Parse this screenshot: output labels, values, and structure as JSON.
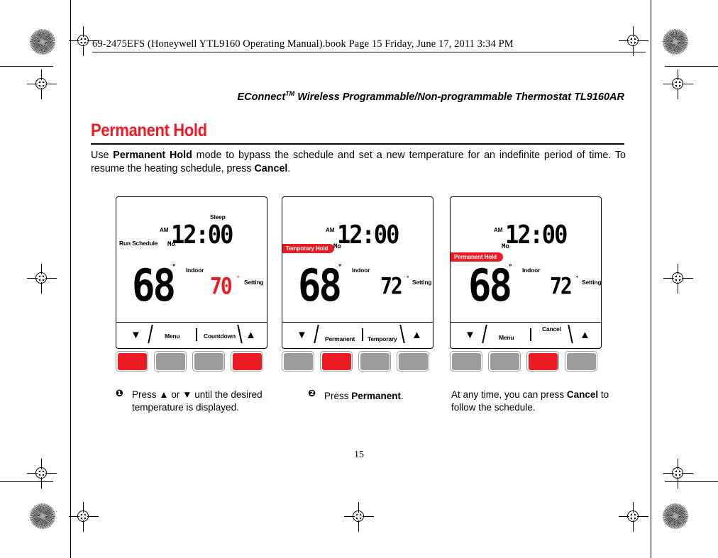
{
  "print_header": {
    "filename_line": "69-2475EFS (Honeywell YTL9160 Operating Manual).book  Page 15  Friday, June 17, 2011  3:34 PM"
  },
  "running_head": {
    "text_before_tm": "EConnect",
    "tm": "TM",
    "text_after_tm": " Wireless Programmable/Non-programmable Thermostat TL9160AR"
  },
  "section": {
    "title": "Permanent Hold",
    "title_color": "#ED1C24",
    "body_part1": "Use ",
    "body_bold1": "Permanent Hold",
    "body_part2": " mode to bypass the schedule and set a new temperature for an indefinite period of time. To resume the heating schedule, press ",
    "body_bold2": "Cancel",
    "body_part3": "."
  },
  "figures": [
    {
      "name": "thermostat-step-1",
      "screen": {
        "mode_label": "Run Schedule",
        "period_label": "Sleep",
        "ampm": "AM",
        "time": "12:00",
        "day": "Mo",
        "indoor_temp": "68",
        "indoor_degree": "°",
        "indoor_label": "Indoor",
        "setting_temp": "70",
        "setting_degree": "°",
        "setting_label": "Setting",
        "setting_is_red": true,
        "hold_badge": null
      },
      "softkeys": {
        "down_arrow": "▼",
        "label_left": "Menu",
        "label_right": "Countdown",
        "up_arrow": "▲"
      },
      "buttons": [
        "red",
        "gray",
        "gray",
        "red"
      ]
    },
    {
      "name": "thermostat-step-2",
      "screen": {
        "mode_label": null,
        "period_label": null,
        "ampm": "AM",
        "time": "12:00",
        "day": "Mo",
        "indoor_temp": "68",
        "indoor_degree": "°",
        "indoor_label": "Indoor",
        "setting_temp": "72",
        "setting_degree": "°",
        "setting_label": "Setting",
        "setting_is_red": false,
        "hold_badge": "Temporary Hold"
      },
      "softkeys": {
        "down_arrow": "▼",
        "label_left": "Permanent",
        "label_right": "Temporary",
        "up_arrow": "▲"
      },
      "buttons": [
        "gray",
        "red",
        "gray",
        "gray"
      ]
    },
    {
      "name": "thermostat-step-3",
      "screen": {
        "mode_label": null,
        "period_label": null,
        "ampm": "AM",
        "time": "12:00",
        "day": "Mo",
        "indoor_temp": "68",
        "indoor_degree": "°",
        "indoor_label": "Indoor",
        "setting_temp": "72",
        "setting_degree": "°",
        "setting_label": "Setting",
        "setting_is_red": false,
        "hold_badge": "Permanent Hold"
      },
      "softkeys": {
        "down_arrow": "▼",
        "label_left": "Menu",
        "label_right": "Cancel",
        "up_arrow": "▲"
      },
      "buttons": [
        "gray",
        "gray",
        "red",
        "gray"
      ]
    }
  ],
  "captions": {
    "step1_num": "❶",
    "step1_text_a": "Press ",
    "step1_arrow_up": "▲",
    "step1_text_b": " or ",
    "step1_arrow_down": "▼",
    "step1_text_c": " until the desired temperature is displayed.",
    "step2_num": "❷",
    "step2_text_a": "Press ",
    "step2_bold": "Permanent",
    "step2_text_b": ".",
    "note_text_a": "At any time, you can press ",
    "note_bold": "Cancel",
    "note_text_b": " to follow the schedule."
  },
  "footer": {
    "page_number": "15"
  }
}
